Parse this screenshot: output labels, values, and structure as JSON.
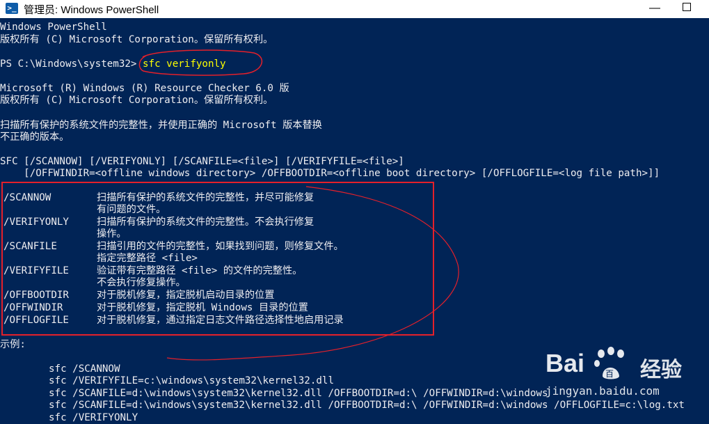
{
  "window": {
    "title": "管理员: Windows PowerShell",
    "app_icon": "powershell-icon",
    "app_icon_glyph": ">_",
    "minimize_glyph": "—"
  },
  "console": {
    "banner": [
      "Windows PowerShell",
      "版权所有 (C) Microsoft Corporation。保留所有权利。"
    ],
    "prompt": "PS C:\\Windows\\system32>",
    "command": "sfc verifyonly",
    "checker_header": [
      "Microsoft (R) Windows (R) Resource Checker 6.0 版",
      "版权所有 (C) Microsoft Corporation。保留所有权利。"
    ],
    "description": [
      "扫描所有保护的系统文件的完整性，并使用正确的 Microsoft 版本替换",
      "不正确的版本。"
    ],
    "usage": [
      "SFC [/SCANNOW] [/VERIFYONLY] [/SCANFILE=<file>] [/VERIFYFILE=<file>]",
      "    [/OFFWINDIR=<offline windows directory> /OFFBOOTDIR=<offline boot directory> [/OFFLOGFILE=<log file path>]]"
    ],
    "options": [
      {
        "flag": "/SCANNOW",
        "desc": [
          "扫描所有保护的系统文件的完整性，并尽可能修复",
          "有问题的文件。"
        ]
      },
      {
        "flag": "/VERIFYONLY",
        "desc": [
          "扫描所有保护的系统文件的完整性。不会执行修复",
          "操作。"
        ]
      },
      {
        "flag": "/SCANFILE",
        "desc": [
          "扫描引用的文件的完整性，如果找到问题，则修复文件。",
          "指定完整路径 <file>"
        ]
      },
      {
        "flag": "/VERIFYFILE",
        "desc": [
          "验证带有完整路径 <file> 的文件的完整性。",
          "不会执行修复操作。"
        ]
      },
      {
        "flag": "/OFFBOOTDIR",
        "desc": [
          "对于脱机修复，指定脱机启动目录的位置"
        ]
      },
      {
        "flag": "/OFFWINDIR",
        "desc": [
          "对于脱机修复，指定脱机 Windows 目录的位置"
        ]
      },
      {
        "flag": "/OFFLOGFILE",
        "desc": [
          "对于脱机修复，通过指定日志文件路径选择性地启用记录"
        ]
      }
    ],
    "examples_label": "示例:",
    "examples": [
      "sfc /SCANNOW",
      "sfc /VERIFYFILE=c:\\windows\\system32\\kernel32.dll",
      "sfc /SCANFILE=d:\\windows\\system32\\kernel32.dll /OFFBOOTDIR=d:\\ /OFFWINDIR=d:\\windows",
      "sfc /SCANFILE=d:\\windows\\system32\\kernel32.dll /OFFBOOTDIR=d:\\ /OFFWINDIR=d:\\windows /OFFLOGFILE=c:\\log.txt",
      "sfc /VERIFYONLY"
    ]
  },
  "watermark": {
    "logo_text": "Bai",
    "logo_suffix": "百",
    "site_cn": "经验",
    "url": "jingyan.baidu.com"
  },
  "colors": {
    "console_bg": "#012456",
    "console_fg": "#eeedf0",
    "command": "#ffff00",
    "annotation": "#e5202a"
  }
}
